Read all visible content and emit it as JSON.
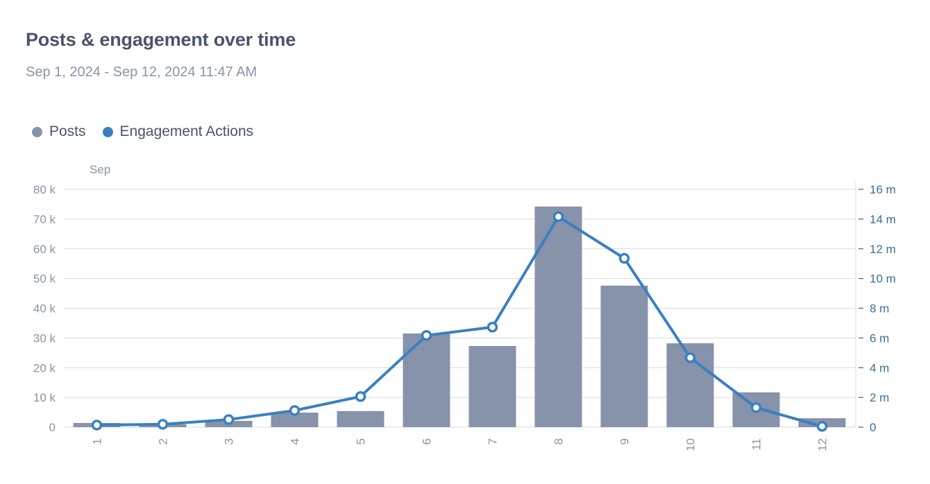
{
  "header": {
    "title": "Posts & engagement over time",
    "subtitle": "Sep 1, 2024 - Sep 12, 2024 11:47 AM"
  },
  "colors": {
    "posts": "#8792ab",
    "engagement": "#3a80bf",
    "grid": "#dbe1e8",
    "left_axis_text": "#8a94a6",
    "right_axis_text": "#3b6e98"
  },
  "chart_data": {
    "type": "bar",
    "title": "Posts & engagement over time",
    "subtitle": "Sep 1, 2024 - Sep 12, 2024 11:47 AM",
    "x_group_label": "Sep",
    "categories": [
      "1",
      "2",
      "3",
      "4",
      "5",
      "6",
      "7",
      "8",
      "9",
      "10",
      "11",
      "12"
    ],
    "legend": [
      "Posts",
      "Engagement Actions"
    ],
    "legend_position": "top-left",
    "grid": true,
    "series": [
      {
        "name": "Posts",
        "type": "bar",
        "axis": "left",
        "values": [
          1400,
          900,
          2100,
          4900,
          5400,
          31500,
          27300,
          74200,
          47600,
          28200,
          11700,
          3000
        ]
      },
      {
        "name": "Engagement Actions",
        "type": "line",
        "axis": "right",
        "values": [
          140000,
          190000,
          510000,
          1120000,
          2060000,
          6170000,
          6730000,
          14160000,
          11360000,
          4670000,
          1310000,
          50000
        ]
      }
    ],
    "y_left": {
      "label": "",
      "range": [
        0,
        80000
      ],
      "ticks": [
        0,
        10000,
        20000,
        30000,
        40000,
        50000,
        60000,
        70000,
        80000
      ],
      "tick_labels": [
        "0",
        "10 k",
        "20 k",
        "30 k",
        "40 k",
        "50 k",
        "60 k",
        "70 k",
        "80 k"
      ]
    },
    "y_right": {
      "label": "",
      "range": [
        0,
        16000000
      ],
      "ticks": [
        0,
        2000000,
        4000000,
        6000000,
        8000000,
        10000000,
        12000000,
        14000000,
        16000000
      ],
      "tick_labels": [
        "0",
        "2 m",
        "4 m",
        "6 m",
        "8 m",
        "10 m",
        "12 m",
        "14 m",
        "16 m"
      ]
    },
    "xlabel": "",
    "ylabel": ""
  }
}
